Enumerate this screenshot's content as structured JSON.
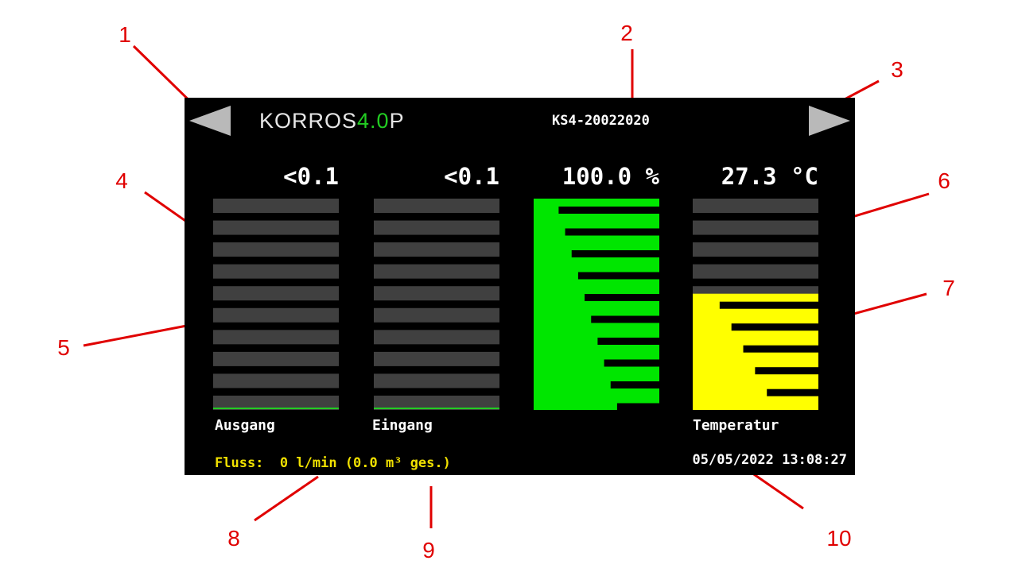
{
  "callouts": [
    "1",
    "2",
    "3",
    "4",
    "5",
    "6",
    "7",
    "8",
    "9",
    "10"
  ],
  "header": {
    "logo_main": "KORROS",
    "logo_accent": "4.0",
    "logo_suffix": "P",
    "device_id": "KS4-20022020"
  },
  "gauges": [
    {
      "name": "ausgang",
      "value_text": "<0.1",
      "label": "Ausgang",
      "level": 0.0,
      "color": "#22cc22"
    },
    {
      "name": "eingang",
      "value_text": "<0.1",
      "label": "Eingang",
      "level": 0.0,
      "color": "#22cc22"
    },
    {
      "name": "percent",
      "value_text": "100.0 %",
      "label": "",
      "level": 1.0,
      "color": "#00e600"
    },
    {
      "name": "temperatur",
      "value_text": "27.3 °C",
      "label": "Temperatur",
      "level": 0.55,
      "color": "#ffff00"
    }
  ],
  "footer": {
    "flow_label": "Fluss:",
    "flow_value": "0 l/min",
    "flow_total": "(0.0 m³ ges.)",
    "datetime": "05/05/2022 13:08:27"
  },
  "colors": {
    "background": "#000000",
    "segment_empty": "#404040",
    "callout": "#e00000",
    "footer_flow": "#f0e000"
  },
  "icons": {
    "left": "triangle-left-icon",
    "right": "triangle-right-icon"
  }
}
